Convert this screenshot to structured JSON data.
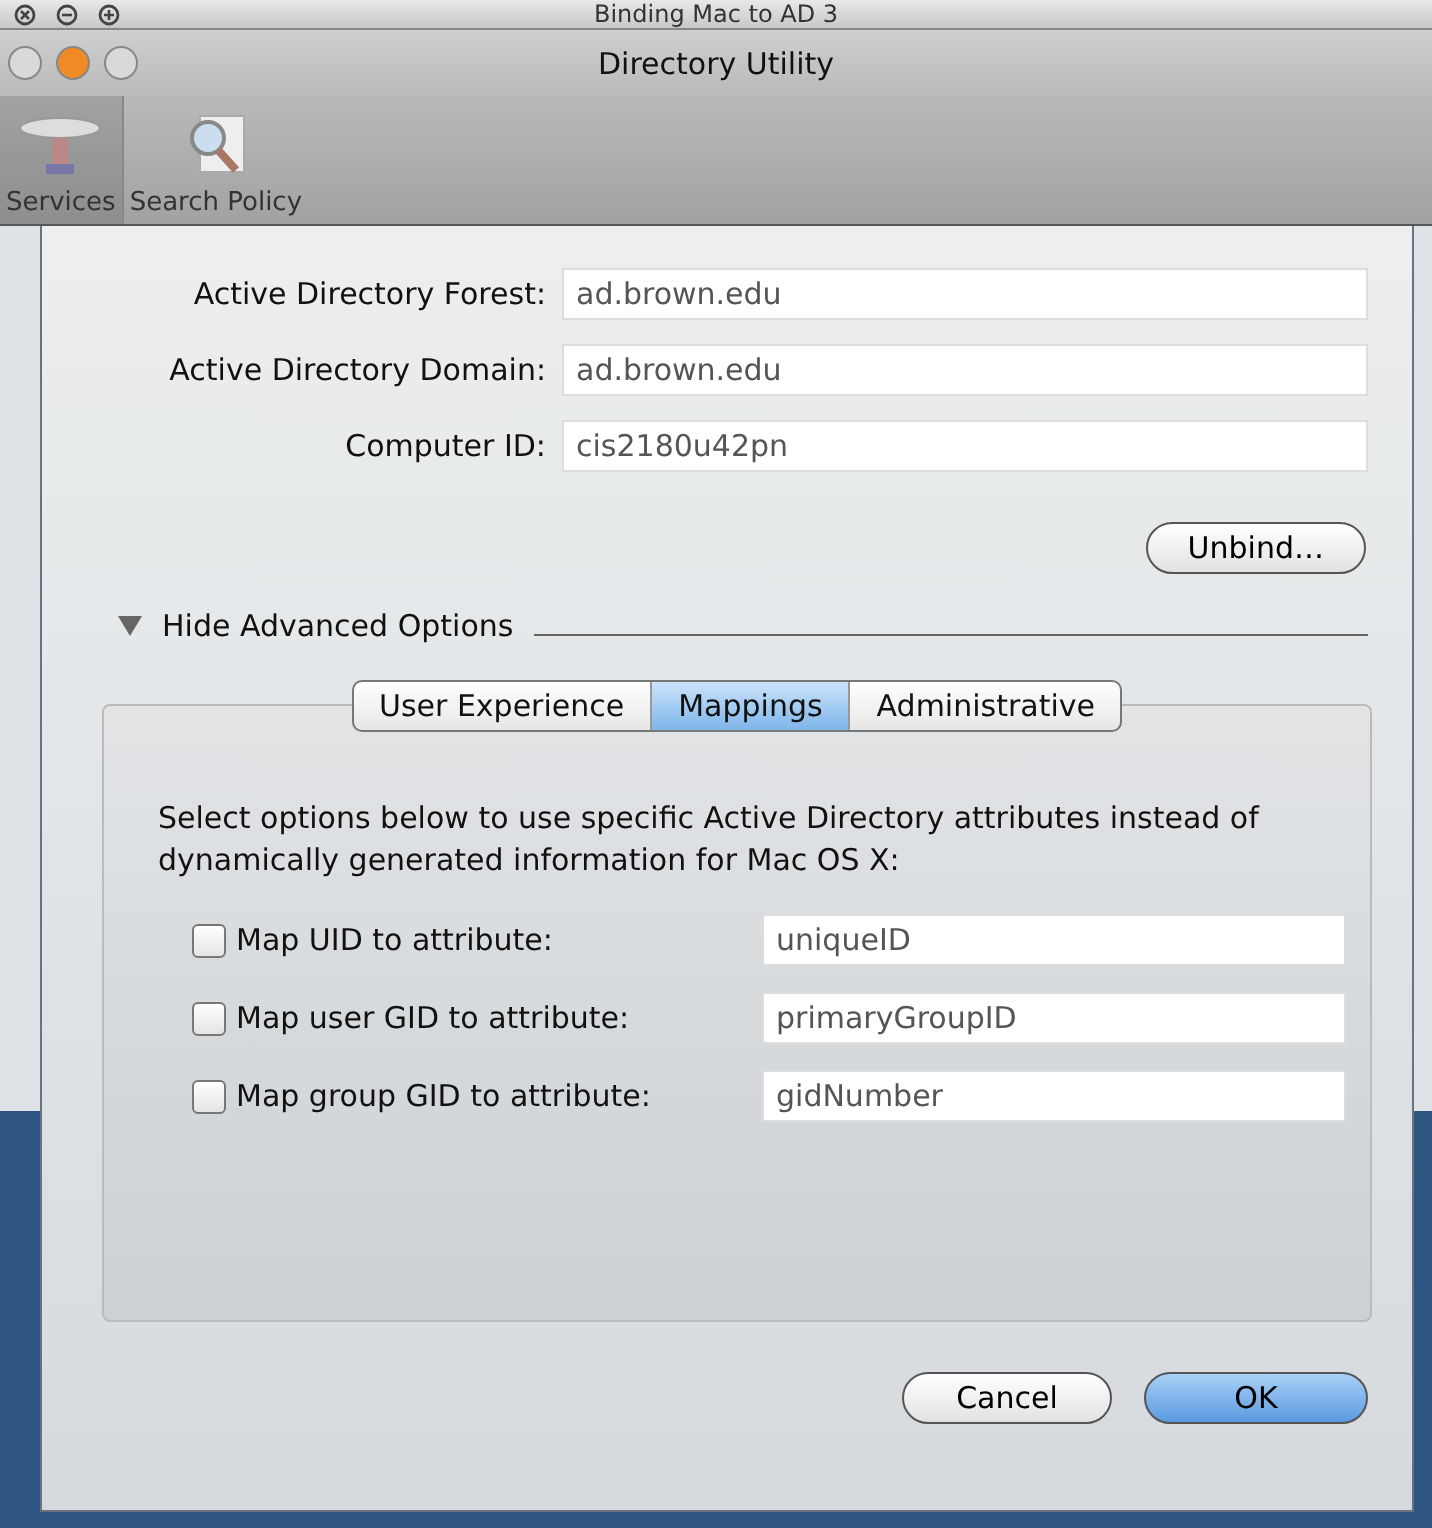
{
  "outer_window": {
    "title": "Binding Mac to AD 3"
  },
  "window": {
    "title": "Directory Utility"
  },
  "toolbar": [
    {
      "label": "Services",
      "selected": true
    },
    {
      "label": "Search Policy",
      "selected": false
    }
  ],
  "form": [
    {
      "label": "Active Directory Forest:",
      "value": "ad.brown.edu"
    },
    {
      "label": "Active Directory Domain:",
      "value": "ad.brown.edu"
    },
    {
      "label": "Computer ID:",
      "value": "cis2180u42pn"
    }
  ],
  "unbind_button": "Unbind…",
  "advanced": {
    "label": "Hide Advanced Options",
    "expanded": true
  },
  "tabs": [
    {
      "label": "User Experience",
      "selected": false
    },
    {
      "label": "Mappings",
      "selected": true
    },
    {
      "label": "Administrative",
      "selected": false
    }
  ],
  "description": "Select options below to use specific Active Directory attributes instead of dynamically generated information for Mac OS X:",
  "mappings": [
    {
      "label": "Map UID to attribute:",
      "checked": false,
      "value": "uniqueID"
    },
    {
      "label": "Map user GID to attribute:",
      "checked": false,
      "value": "primaryGroupID"
    },
    {
      "label": "Map group GID to attribute:",
      "checked": false,
      "value": "gidNumber"
    }
  ],
  "buttons": [
    {
      "label": "Cancel",
      "kind": "normal"
    },
    {
      "label": "OK",
      "kind": "default"
    }
  ]
}
